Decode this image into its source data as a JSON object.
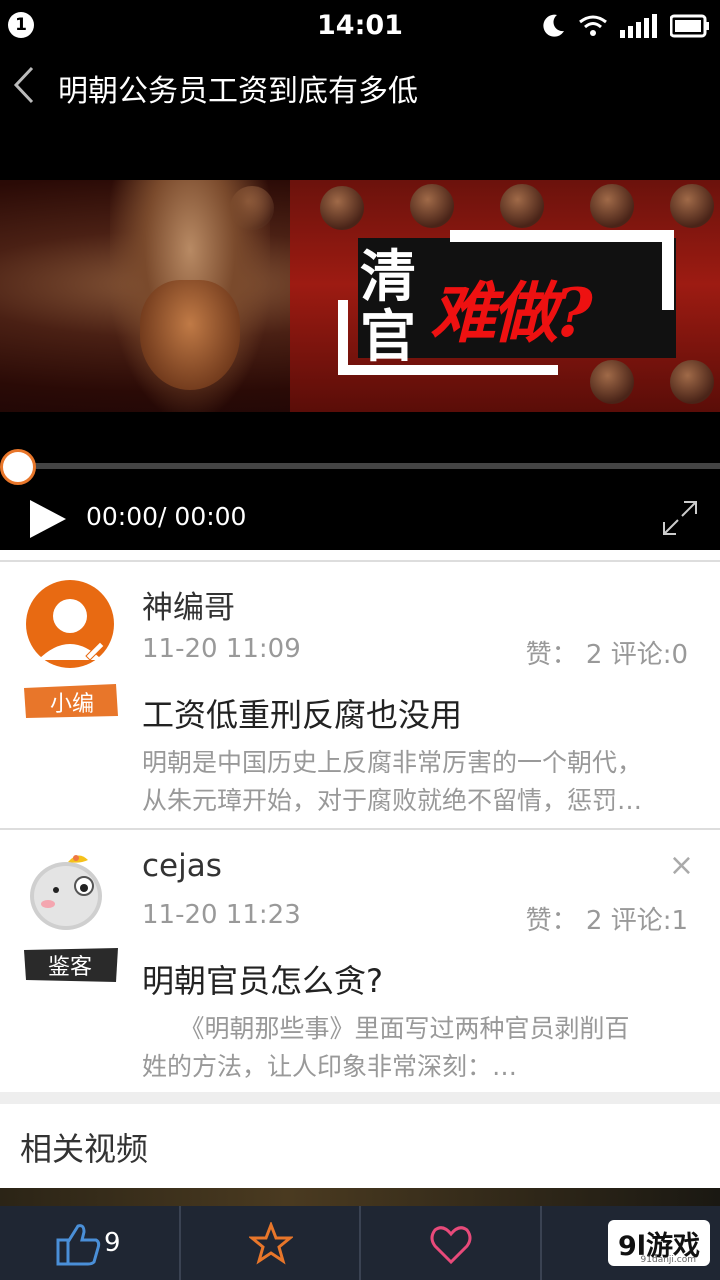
{
  "status_bar": {
    "notification_count": "1",
    "time": "14:01",
    "icons": [
      "moon-icon",
      "wifi-icon",
      "signal-icon",
      "battery-icon"
    ]
  },
  "header": {
    "title": "明朝公务员工资到底有多低",
    "back_icon": "chevron-left-icon"
  },
  "video": {
    "headline_chars": [
      "清",
      "官"
    ],
    "headline_red": "难做?",
    "progress": 0,
    "time_display": "00:00/ 00:00",
    "accent_color": "#e8762a"
  },
  "comments": [
    {
      "user": "神编哥",
      "role_badge": "小编",
      "time": "11-20 11:09",
      "stats": "赞： 2  评论:0",
      "heading": "工资低重刑反腐也没用",
      "body_line1": "明朝是中国历史上反腐非常厉害的一个朝代，",
      "body_line2": "从朱元璋开始，对于腐败就绝不留情，惩罚…"
    },
    {
      "user": "cejas",
      "role_badge": "鉴客",
      "time": "11-20 11:23",
      "stats": "赞： 2  评论:1",
      "heading": "明朝官员怎么贪?",
      "body_line1": "　　《明朝那些事》里面写过两种官员剥削百",
      "body_line2": "姓的方法，让人印象非常深刻：…",
      "close": "×"
    }
  ],
  "related": {
    "title": "相关视频"
  },
  "bottom_bar": {
    "like_count": "9",
    "watermark": "9l游戏",
    "watermark_sub": "91danji.com",
    "bar_color": "#1f2633"
  }
}
